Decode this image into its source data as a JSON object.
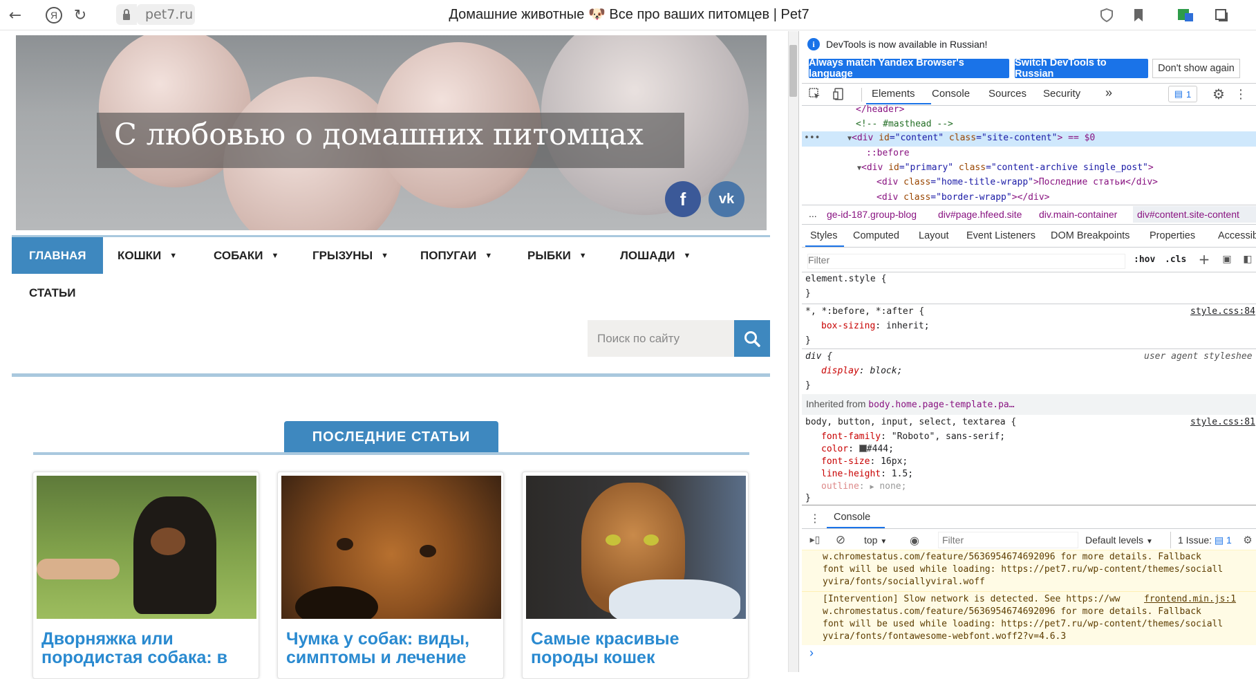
{
  "browser": {
    "url": "pet7.ru",
    "title": "Домашние животные 🐶 Все про ваших питомцев | Pet7"
  },
  "site": {
    "hero_title": "С любовью о домашних питомцах",
    "social": {
      "facebook": "f",
      "vk": "vk"
    },
    "nav": [
      "ГЛАВНАЯ",
      "КОШКИ",
      "СОБАКИ",
      "ГРЫЗУНЫ",
      "ПОПУГАИ",
      "РЫБКИ",
      "ЛОШАДИ",
      "СТАТЬИ"
    ],
    "search_placeholder": "Поиск по сайту",
    "latest_label": "ПОСЛЕДНИЕ СТАТЬИ",
    "cards": [
      {
        "title": "Дворняжка или породистая собака: в"
      },
      {
        "title": "Чумка у собак: виды, симптомы и лечение"
      },
      {
        "title": "Самые красивые породы кошек"
      }
    ]
  },
  "devtools": {
    "info": "DevTools is now available in Russian!",
    "btn_match": "Always match Yandex Browser's language",
    "btn_switch": "Switch DevTools to Russian",
    "btn_dont": "Don't show again",
    "tabs": [
      "Elements",
      "Console",
      "Sources",
      "Security"
    ],
    "more": "»",
    "issues_count": "1",
    "dom": {
      "l1": "</header>",
      "l2": "<!-- #masthead -->",
      "l3a": "<div ",
      "l3b": "id",
      "l3c": "=\"content\" ",
      "l3d": "class",
      "l3e": "=\"site-content\"",
      "l3f": "> == $0",
      "l4": "::before",
      "l5a": "<div ",
      "l5b": "id",
      "l5c": "=\"primary\" ",
      "l5d": "class",
      "l5e": "=\"content-archive single_post\"",
      "l5f": ">",
      "l6a": "<div ",
      "l6b": "class",
      "l6c": "=\"home-title-wrapp\"",
      "l6d": ">Последние статьи</div>",
      "l7a": "<div ",
      "l7b": "class",
      "l7c": "=\"border-wrapp\"",
      "l7d": "></div>"
    },
    "crumbs": [
      "...",
      "ge-id-187.group-blog",
      "div#page.hfeed.site",
      "div.main-container",
      "div#content.site-content"
    ],
    "subtabs": [
      "Styles",
      "Computed",
      "Layout",
      "Event Listeners",
      "DOM Breakpoints",
      "Properties",
      "Accessibi"
    ],
    "filter_placeholder": "Filter",
    "hov": ":hov",
    "cls": ".cls",
    "styles": {
      "r1_sel": "element.style {",
      "close": "}",
      "r2_sel": "*, *:before, *:after {",
      "r2_src": "style.css:84",
      "r2_p": "box-sizing",
      "r2_v": "inherit;",
      "r3_sel": "div {",
      "r3_src": "user agent styleshee",
      "r3_p": "display",
      "r3_v": "block;",
      "inherited": "Inherited from",
      "inherited_sel": "body.home.page-template.pa…",
      "r4_sel": "body, button, input, select, textarea {",
      "r4_src": "style.css:81",
      "props": [
        {
          "p": "font-family",
          "v": "\"Roboto\", sans-serif;"
        },
        {
          "p": "color",
          "v": "#444;"
        },
        {
          "p": "font-size",
          "v": "16px;"
        },
        {
          "p": "line-height",
          "v": "1.5;"
        },
        {
          "p": "outline",
          "v": "none;"
        }
      ]
    },
    "drawer_title": "Console",
    "console": {
      "context": "top",
      "filter": "Filter",
      "levels": "Default levels",
      "issues": "1 Issue:",
      "issues_n": "1",
      "m1": [
        "w.chromestatus.com/feature/5636954674692096 for more details. Fallback",
        "font will be used while loading: https://pet7.ru/wp-content/themes/sociall",
        "yvira/fonts/sociallyviral.woff"
      ],
      "m2": [
        "[Intervention] Slow network is detected. See https://ww",
        "w.chromestatus.com/feature/5636954674692096 for more details. Fallback",
        "font will be used while loading: https://pet7.ru/wp-content/themes/sociall",
        "yvira/fonts/fontawesome-webfont.woff2?v=4.6.3"
      ],
      "m2_src": "frontend.min.js:1",
      "prompt": "›"
    }
  }
}
